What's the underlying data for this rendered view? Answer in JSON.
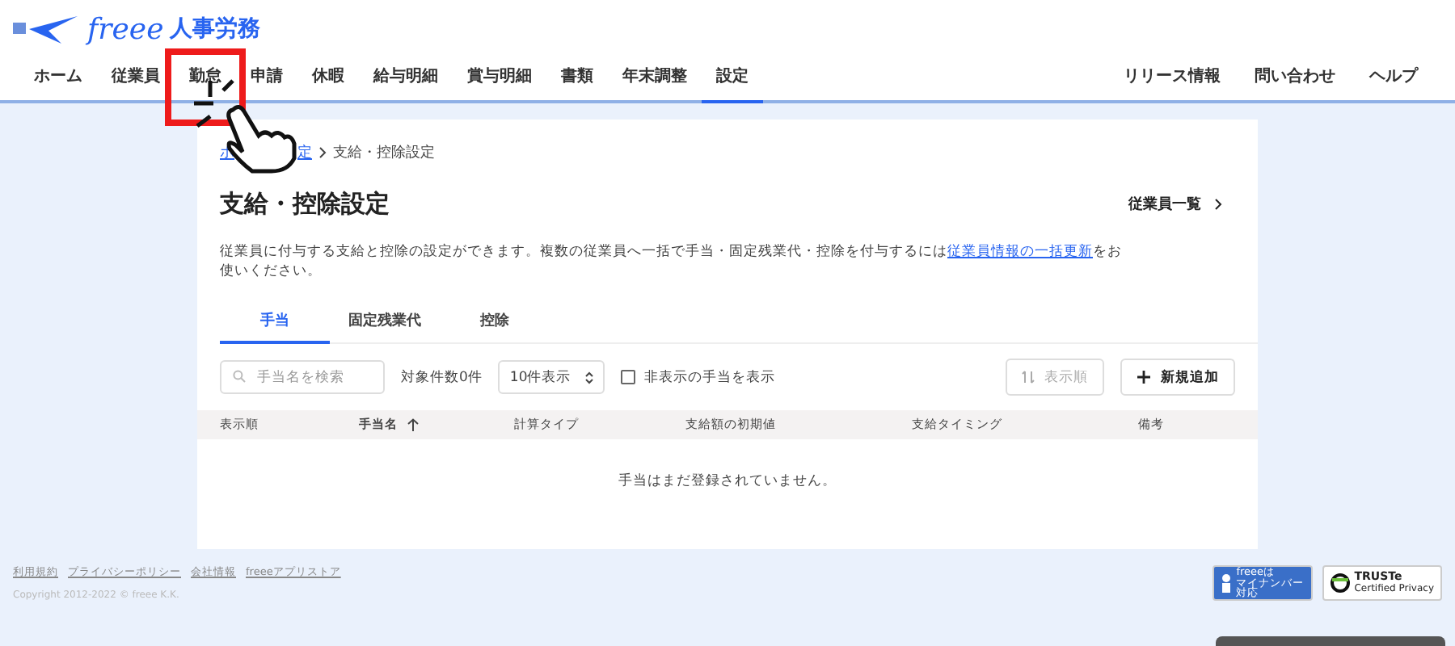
{
  "header": {
    "logo_text": "freee",
    "product": "人事労務"
  },
  "nav": [
    {
      "label": "ホーム",
      "selected": false
    },
    {
      "label": "従業員",
      "selected": false
    },
    {
      "label": "勤怠",
      "selected": false
    },
    {
      "label": "申請",
      "selected": false
    },
    {
      "label": "休暇",
      "selected": false
    },
    {
      "label": "給与明細",
      "selected": false
    },
    {
      "label": "賞与明細",
      "selected": false
    },
    {
      "label": "書類",
      "selected": false
    },
    {
      "label": "年末調整",
      "selected": false
    },
    {
      "label": "設定",
      "selected": true
    }
  ],
  "nav_right": [
    "リリース情報",
    "問い合わせ",
    "ヘルプ"
  ],
  "breadcrumb": [
    {
      "label": "ホ",
      "kind": "link"
    },
    {
      "label": "定",
      "kind": "link"
    },
    {
      "label": "支給・控除設定",
      "kind": "current"
    }
  ],
  "page": {
    "title": "支給・控除設定",
    "side_link": "従業員一覧",
    "description_before": "従業員に付与する支給と控除の設定ができます。複数の従業員へ一括で手当・固定残業代・控除を付与するには",
    "description_link": "従業員情報の一括更新",
    "description_after": "をお使いください。"
  },
  "tabs": [
    {
      "label": "手当",
      "selected": true
    },
    {
      "label": "固定残業代",
      "selected": false
    },
    {
      "label": "控除",
      "selected": false
    }
  ],
  "toolbar": {
    "search_placeholder": "手当名を検索",
    "count": "対象件数0件",
    "per_page": "10件表示",
    "show_hidden": {
      "label": "非表示の手当を表示",
      "checked": false
    },
    "sort_button": {
      "label": "表示順",
      "disabled": true
    },
    "add_button": "新規追加"
  },
  "table": {
    "columns": [
      {
        "label": "表示順",
        "sorted": false
      },
      {
        "label": "手当名",
        "sorted": true
      },
      {
        "label": "計算タイプ",
        "sorted": false
      },
      {
        "label": "支給額の初期値",
        "sorted": false
      },
      {
        "label": "支給タイミング",
        "sorted": false
      },
      {
        "label": "備考",
        "sorted": false
      }
    ],
    "empty_message": "手当はまだ登録されていません。"
  },
  "footer": {
    "links": [
      "利用規約",
      "プライバシーポリシー",
      "会社情報",
      "freeeアプリストア"
    ],
    "copyright": "Copyright 2012-2022 © freee K.K.",
    "badges": [
      "freeeは",
      "マイナンバー",
      "対応",
      "TRUSTe",
      "Certified Privacy"
    ]
  }
}
